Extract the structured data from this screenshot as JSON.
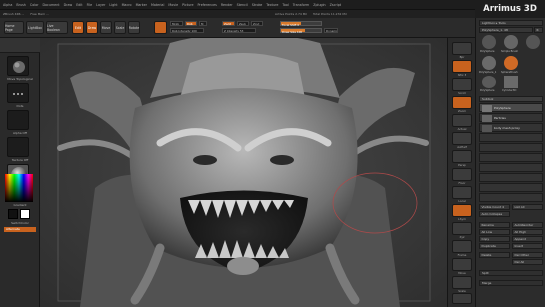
{
  "brand": "Arrimus 3D",
  "menubar": {
    "items": [
      "Alpha",
      "Brush",
      "Color",
      "Document",
      "Draw",
      "Edit",
      "File",
      "Layer",
      "Light",
      "Macro",
      "Marker",
      "Material",
      "Movie",
      "Picture",
      "Preferences",
      "Render",
      "Stencil",
      "Stroke",
      "Texture",
      "Tool",
      "Transform",
      "Zplugin",
      "Zscript"
    ]
  },
  "subbar": {
    "text1": "ZBrush 4R6 ...",
    "text2": "Free Mem ...",
    "text3": "Active Points 2.74 Mil",
    "text4": "Total Points 11.232 Mil"
  },
  "toolbar": {
    "home_page": "Home Page",
    "lightbox": "LightBox",
    "live_boolean": "Live Boolean",
    "edit": "Edit",
    "draw": "Draw",
    "move": "Move",
    "scale": "Scale",
    "rotate": "Rotate",
    "mrgb": "Mrgb",
    "rgb": "Rgb",
    "m": "M",
    "zadd": "Zadd",
    "zsub": "Zsub",
    "zcut": "Zcut",
    "rgb_intensity": "Rgb Intensity 100",
    "z_intensity": "Z Intensity 53",
    "focal_shift": "Focal Shift 0",
    "draw_size": "Draw Size 100",
    "dynamic": "Dynamic"
  },
  "left_panel": {
    "move_topological": "Move Topological",
    "dots": "Dots",
    "alpha_off": "Alpha Off",
    "texture_off": "Texture Off",
    "material": "Gradient",
    "switch_color": "SwitchColor",
    "alternate": "Alternate"
  },
  "right_shelf": {
    "labels": [
      "Bpr",
      "SPix 3",
      "Scroll",
      "Zoom",
      "Actual",
      "AAHalf",
      "Persp",
      "Floor",
      "Local",
      "LSym",
      "Xyz",
      "Frame",
      "Move",
      "Scale",
      "Rotate",
      "PolyF",
      "Transp",
      "Dynamic",
      "Solo",
      "Xpose"
    ]
  },
  "right_panel": {
    "lightbox_tools": "Lightbox ▸ Tools",
    "polysphere": "PolySphere_1. 48",
    "r": "R",
    "thumbnails": [
      "PolySphere",
      "Simple Brush",
      "PolySphere_1",
      "SphereBrush",
      "PolySphere",
      "Cylinder3D"
    ],
    "subtool_header": "Subtool",
    "subtools": [
      "PolySphere",
      "Partcles",
      "body mesh proxy"
    ],
    "visible_count": "Visible Count 4",
    "list_all": "List All",
    "auto_collapse": "Auto Collapse",
    "rename": "Rename",
    "autoreorder": "AutoReorder",
    "all_low": "All Low",
    "all_high": "All High",
    "copy": "Copy",
    "append": "Append",
    "duplicate": "Duplicate",
    "insert": "Insert",
    "delete": "Delete",
    "del_other": "Del Other",
    "del_all": "Del All",
    "split": "Split",
    "merge": "Merge"
  },
  "colors": {
    "accent": "#c8621e",
    "panel": "#2c2c2c",
    "viewport": "#3a3a3a"
  }
}
